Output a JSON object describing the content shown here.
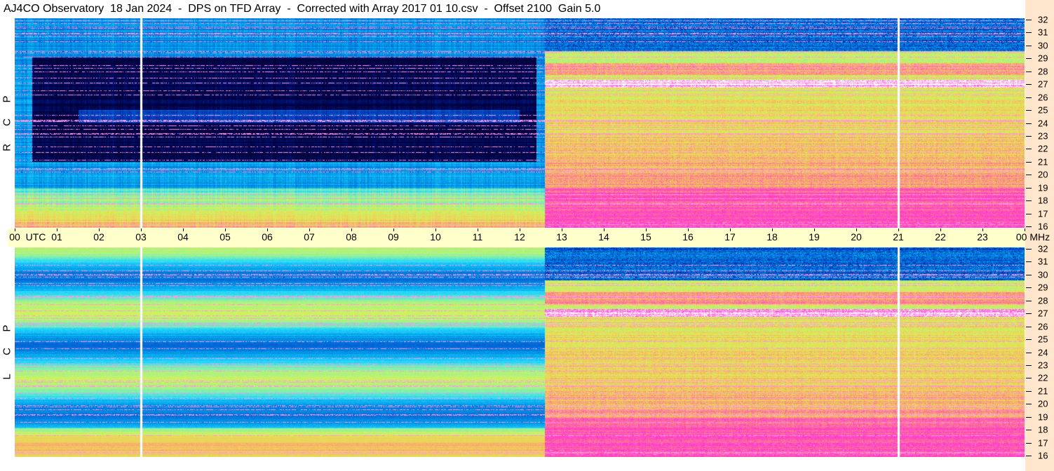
{
  "title": "AJ4CO Observatory  18 Jan 2024  -  DPS on TFD Array  -  Corrected with Array 2017 01 10.csv  -  Offset 2100  Gain 5.0",
  "time_axis": {
    "labels": [
      "00",
      "UTC",
      "01",
      "02",
      "03",
      "04",
      "05",
      "06",
      "07",
      "08",
      "09",
      "10",
      "11",
      "12",
      "13",
      "14",
      "15",
      "16",
      "17",
      "18",
      "19",
      "20",
      "21",
      "22",
      "23",
      "00 MHz"
    ]
  },
  "freq_axis": {
    "labels": [
      "32",
      "31",
      "30",
      "29",
      "28",
      "27",
      "26",
      "25",
      "24",
      "23",
      "22",
      "21",
      "20",
      "19",
      "18",
      "17",
      "16"
    ]
  },
  "panels": [
    {
      "polarization": [
        "R",
        "C",
        "P"
      ]
    },
    {
      "polarization": [
        "L",
        "C",
        "P"
      ]
    }
  ],
  "colors": {
    "background": "#ffffff",
    "axis_band": "#ffffcc",
    "freq_band": "#ffe6cc"
  },
  "chart_data": {
    "type": "heatmap",
    "title": "AJ4CO Observatory  18 Jan 2024  -  DPS on TFD Array  -  Corrected with Array 2017 01 10.csv  -  Offset 2100  Gain 5.0",
    "xlabel": "UTC",
    "ylabel": "MHz",
    "xlim": [
      0,
      24
    ],
    "ylim": [
      16,
      32
    ],
    "x_ticks": [
      "00",
      "01",
      "02",
      "03",
      "04",
      "05",
      "06",
      "07",
      "08",
      "09",
      "10",
      "11",
      "12",
      "13",
      "14",
      "15",
      "16",
      "17",
      "18",
      "19",
      "20",
      "21",
      "22",
      "23",
      "00"
    ],
    "y_ticks": [
      32,
      31,
      30,
      29,
      28,
      27,
      26,
      25,
      24,
      23,
      22,
      21,
      20,
      19,
      18,
      17,
      16
    ],
    "panels": [
      "RCP",
      "LCP"
    ],
    "colormap": [
      "#00003a",
      "#001a8c",
      "#0050d0",
      "#009be8",
      "#22d6ff",
      "#7ff0b0",
      "#d4f25a",
      "#f3c85a",
      "#ff6fa0",
      "#ff2fcf",
      "#ffffff"
    ],
    "features": {
      "sunrise_transition_utc": 12.6,
      "vertical_lines_utc": [
        3.0,
        21.0
      ],
      "bright_interference_mhz": 27.0
    }
  }
}
